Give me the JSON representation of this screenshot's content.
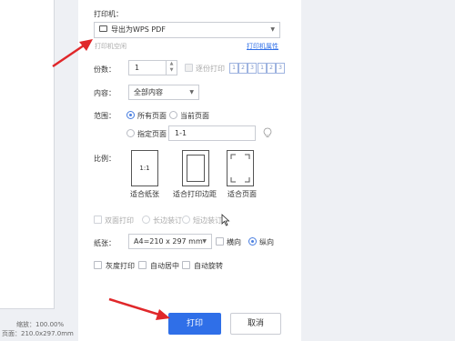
{
  "preview": {
    "zoom_label": "缩放：100.00%",
    "page_size_label": "页面：210.0x297.0mm"
  },
  "printer": {
    "section_label": "打印机：",
    "selected": "导出为WPS PDF",
    "printer_status": "打印机空闲",
    "properties_link": "打印机属性"
  },
  "copies": {
    "label": "份数：",
    "value": "1",
    "collate_label": "逐份打印",
    "collate_icons": [
      "1",
      "2",
      "3",
      "1",
      "2",
      "3"
    ]
  },
  "content": {
    "label": "内容：",
    "selected": "全部内容"
  },
  "range": {
    "label": "范围：",
    "all_pages": "所有页面",
    "current_page": "当前页面",
    "specified_pages": "指定页面",
    "pages_value": "1-1"
  },
  "scale": {
    "label": "比例：",
    "fit_paper": "适合纸张",
    "fit_margins": "适合打印边距",
    "fit_page": "适合页面",
    "box_text": "1:1"
  },
  "duplex": {
    "label": "双面打印",
    "long_edge": "长边装订",
    "short_edge": "短边装订"
  },
  "paper": {
    "label": "纸张：",
    "selected": "A4=210 x 297 mm",
    "landscape": "横向",
    "portrait": "纵向"
  },
  "options": {
    "grayscale": "灰度打印",
    "auto_center": "自动居中",
    "auto_rotate": "自动旋转"
  },
  "buttons": {
    "print": "打印",
    "cancel": "取消"
  },
  "colors": {
    "accent": "#2f6fe8",
    "annotation_arrow": "#e0272a"
  }
}
